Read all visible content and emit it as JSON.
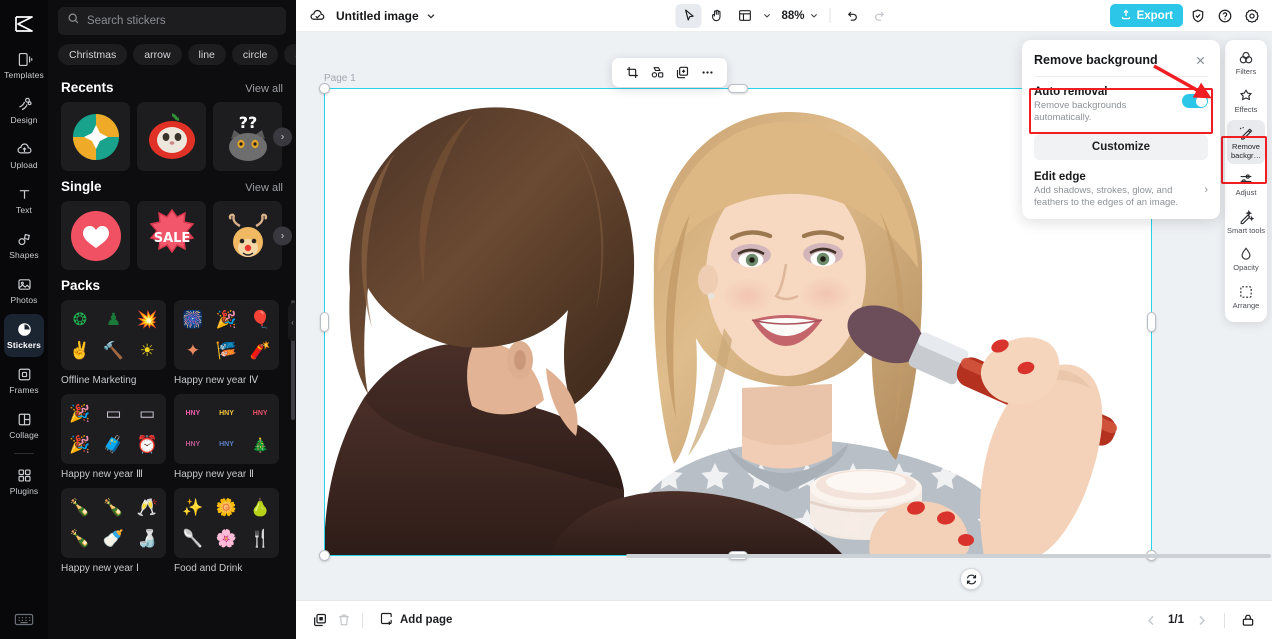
{
  "app": {
    "logo_icon": "capcut-logo",
    "keyboard_icon": "keyboard-shortcuts-icon"
  },
  "left_rail": {
    "items": [
      {
        "label": "Templates",
        "icon": "templates-icon",
        "active": false
      },
      {
        "label": "Design",
        "icon": "design-icon",
        "active": false
      },
      {
        "label": "Upload",
        "icon": "upload-cloud-icon",
        "active": false
      },
      {
        "label": "Text",
        "icon": "text-icon",
        "active": false
      },
      {
        "label": "Shapes",
        "icon": "shapes-icon",
        "active": false
      },
      {
        "label": "Photos",
        "icon": "photos-icon",
        "active": false
      },
      {
        "label": "Stickers",
        "icon": "stickers-icon",
        "active": true
      },
      {
        "label": "Frames",
        "icon": "frames-icon",
        "active": false
      },
      {
        "label": "Collage",
        "icon": "collage-icon",
        "active": false
      },
      {
        "label": "Plugins",
        "icon": "plugins-icon",
        "active": false
      }
    ]
  },
  "panel": {
    "search": {
      "placeholder": "Search stickers",
      "icon": "search-icon",
      "value": ""
    },
    "tags": [
      "Christmas",
      "arrow",
      "line",
      "circle",
      "sq"
    ],
    "sections": [
      {
        "title": "Recents",
        "view_all": "View all"
      },
      {
        "title": "Single",
        "view_all": "View all"
      },
      {
        "title": "Packs",
        "view_all": ""
      }
    ],
    "packs": [
      {
        "name": "Offline Marketing",
        "glyphs": [
          "❂",
          "♟",
          "💥",
          "✌",
          "🔨",
          "☀"
        ]
      },
      {
        "name": "Happy new year Ⅳ",
        "glyphs": [
          "🎆",
          "🎉",
          "🎈",
          "✦",
          "🎏",
          "🧨"
        ]
      },
      {
        "name": "Happy new year Ⅲ",
        "glyphs": [
          "🎉",
          "▭",
          "▭",
          "🎉",
          "🧳",
          "⏰"
        ]
      },
      {
        "name": "Happy new year Ⅱ",
        "glyphs": [
          "HNY",
          "HNY",
          "HNY",
          "HNY",
          "HNY",
          "🎄"
        ]
      },
      {
        "name": "Happy new year Ⅰ",
        "glyphs": [
          "🍾",
          "🍾",
          "🥂",
          "🍾",
          "🍼",
          "🍶"
        ]
      },
      {
        "name": "Food and Drink",
        "glyphs": [
          "✨",
          "🌼",
          "🍐",
          "🥄",
          "🌸",
          "🍴"
        ]
      }
    ],
    "next_arrow_icon": "chevron-right-icon"
  },
  "topbar": {
    "cloud_icon": "cloud-saved-icon",
    "doc_title": "Untitled image",
    "title_caret_icon": "chevron-down-icon",
    "tools": [
      {
        "name": "select-tool",
        "icon": "cursor-arrow-icon",
        "active": true
      },
      {
        "name": "hand-tool",
        "icon": "hand-icon",
        "active": false
      },
      {
        "name": "frame-tool",
        "icon": "layout-frame-icon",
        "active": false
      }
    ],
    "zoom": "88%",
    "undo_icon": "undo-icon",
    "redo_icon": "redo-icon",
    "export_label": "Export",
    "export_icon": "export-upload-icon",
    "export_color": "#2cc7e8",
    "right_icons": [
      {
        "name": "shield-check-icon"
      },
      {
        "name": "help-circle-icon"
      },
      {
        "name": "gear-icon"
      }
    ]
  },
  "canvas": {
    "page_label": "Page 1",
    "selection_color": "#27d3e8",
    "rotate_icon": "rotate-icon",
    "float_toolbar": [
      {
        "name": "crop-icon"
      },
      {
        "name": "mask-shape-icon"
      },
      {
        "name": "duplicate-icon"
      },
      {
        "name": "more-options-icon"
      }
    ]
  },
  "bottombar": {
    "duplicate_page_icon": "duplicate-page-icon",
    "delete_page_icon": "trash-icon",
    "add_page_label": "Add page",
    "add_page_icon": "add-page-icon",
    "prev_icon": "chevron-left-icon",
    "next_icon": "chevron-right-icon",
    "page_count": "1/1",
    "lock_icon": "lock-icon"
  },
  "right_rail": {
    "items": [
      {
        "label": "Filters",
        "icon": "filters-icon",
        "active": false
      },
      {
        "label": "Effects",
        "icon": "effects-icon",
        "active": false
      },
      {
        "label": "Remove backgr…",
        "icon": "remove-background-icon",
        "active": true
      },
      {
        "label": "Adjust",
        "icon": "adjust-sliders-icon",
        "active": false
      },
      {
        "label": "Smart tools",
        "icon": "smart-tools-icon",
        "active": false
      },
      {
        "label": "Opacity",
        "icon": "opacity-drop-icon",
        "active": false
      },
      {
        "label": "Arrange",
        "icon": "arrange-icon",
        "active": false
      }
    ],
    "highlight_color": "#f01e22"
  },
  "popup": {
    "title": "Remove background",
    "close_icon": "close-icon",
    "auto": {
      "title": "Auto removal",
      "subtitle": "Remove backgrounds automatically.",
      "toggle_on": true,
      "toggle_color": "#2cc7e8"
    },
    "customize_label": "Customize",
    "edge": {
      "title": "Edit edge",
      "subtitle": "Add shadows, strokes, glow, and feathers to the edges of an image.",
      "chevron_icon": "chevron-right-icon"
    },
    "annotation": {
      "color": "#f01e22",
      "arrow_icon": "red-arrow-icon"
    }
  }
}
